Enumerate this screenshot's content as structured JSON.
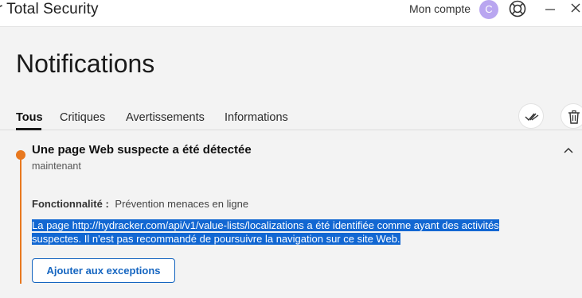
{
  "window": {
    "app_title": "er Total Security",
    "account_label": "Mon compte",
    "avatar_initial": "C"
  },
  "page": {
    "title": "Notifications"
  },
  "tabs": [
    {
      "label": "Tous",
      "active": true
    },
    {
      "label": "Critiques",
      "active": false
    },
    {
      "label": "Avertissements",
      "active": false
    },
    {
      "label": "Informations",
      "active": false
    }
  ],
  "notification": {
    "title": "Une page Web suspecte a été détectée",
    "time": "maintenant",
    "feature_label": "Fonctionnalité :",
    "feature_value": "Prévention menaces en ligne",
    "description": "La page http://hydracker.com/api/v1/value-lists/localizations a été identifiée comme ayant des activités suspectes. Il n'est pas recommandé de poursuivre la navigation sur ce site Web.",
    "action_label": "Ajouter aux exceptions"
  },
  "colors": {
    "accent": "#e8781f",
    "link_blue": "#1565c0",
    "selection": "#1267d2",
    "avatar": "#b9a6f0"
  }
}
